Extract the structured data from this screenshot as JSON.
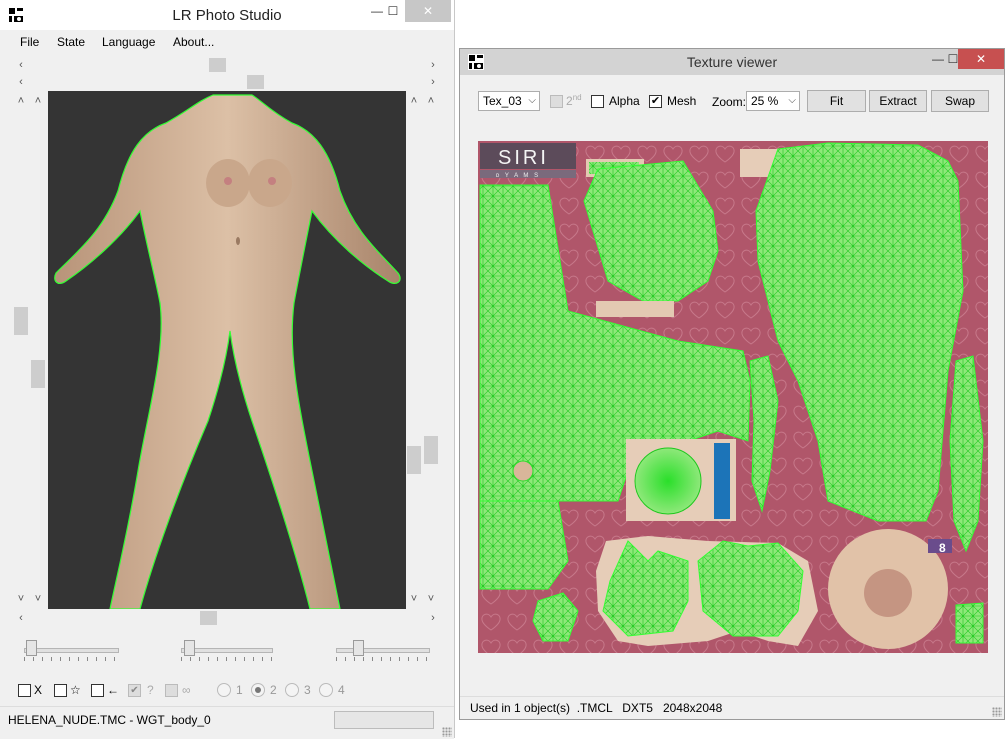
{
  "left_window": {
    "title": "LR Photo Studio",
    "controls": {
      "minimize": "—",
      "maximize": "☐",
      "close": "✕"
    },
    "menu": [
      "File",
      "State",
      "Language",
      "About..."
    ],
    "checkboxes": [
      {
        "label": "X",
        "checked": false
      },
      {
        "label": "☆",
        "checked": false
      },
      {
        "label": "←",
        "checked": false
      },
      {
        "label": "?",
        "checked": true,
        "disabled": true
      },
      {
        "label": "∞",
        "checked": false,
        "disabled": true
      }
    ],
    "radios": [
      {
        "label": "1",
        "selected": false
      },
      {
        "label": "2",
        "selected": true
      },
      {
        "label": "3",
        "selected": false
      },
      {
        "label": "4",
        "selected": false
      }
    ],
    "status": "HELENA_NUDE.TMC - WGT_body_0"
  },
  "right_window": {
    "title": "Texture viewer",
    "texture_select": "Tex_03",
    "second_label": "2",
    "second_sup": "nd",
    "alpha_label": "Alpha",
    "alpha_checked": false,
    "mesh_label": "Mesh",
    "mesh_checked": true,
    "zoom_label": "Zoom:",
    "zoom_value": "25 %",
    "fit_label": "Fit",
    "extract_label": "Extract",
    "swap_label": "Swap",
    "logo_text": "SIRI",
    "logo_sub": "ᴅ Y A M S",
    "badge_8": "8",
    "status": "Used in 1 object(s)  .TMCL   DXT5   2048x2048"
  },
  "colors": {
    "mesh": "#33ff33",
    "texture_bg": "#b0566a",
    "viewport_bg": "#343434",
    "skin": "#d2b093"
  }
}
